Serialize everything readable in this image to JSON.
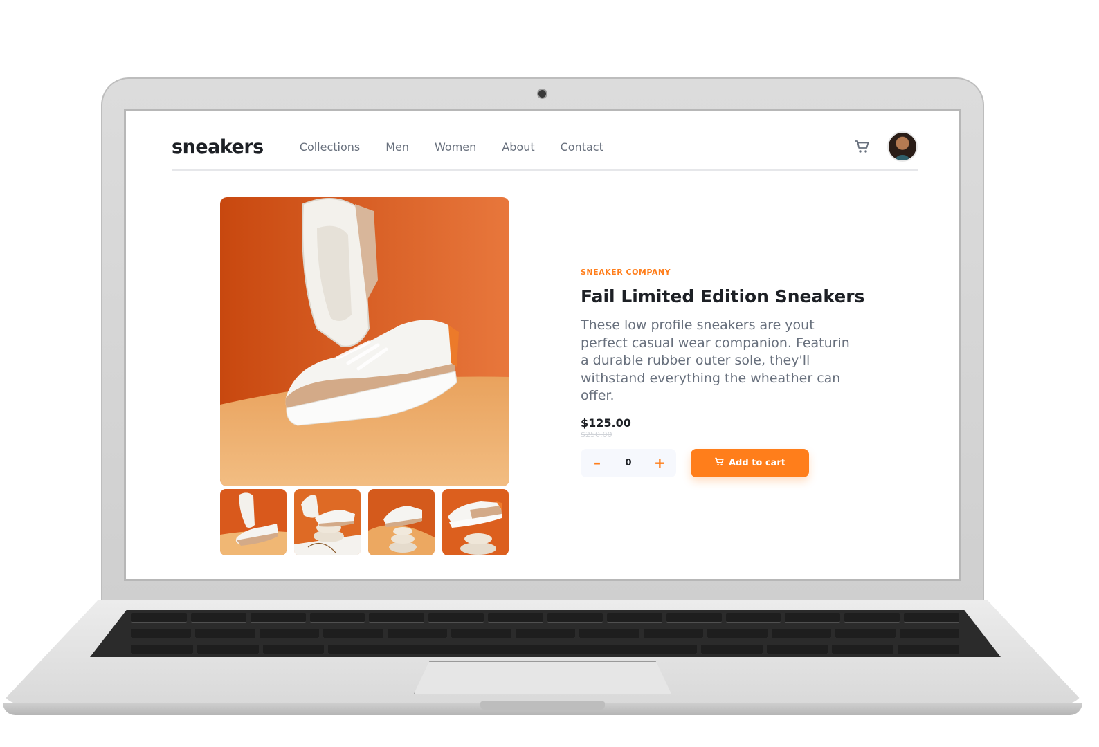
{
  "brand": {
    "logo": "sneakers"
  },
  "nav": {
    "items": [
      {
        "label": "Collections"
      },
      {
        "label": "Men"
      },
      {
        "label": "Women"
      },
      {
        "label": "About"
      },
      {
        "label": "Contact"
      }
    ],
    "cart_icon": "cart-icon",
    "avatar_icon": "avatar"
  },
  "product": {
    "company": "SNEAKER COMPANY",
    "title": "Fail Limited Edition Sneakers",
    "description": "These low profile sneakers are yout perfect casual wear companion. Featurin a durable rubber outer sole, they'll withstand everything the wheather can offer.",
    "price": "$125.00",
    "original_price": "$250.00",
    "quantity": "0",
    "decrement_label": "–",
    "increment_label": "+",
    "add_to_cart_label": "Add to cart"
  },
  "gallery": {
    "thumbnail_count": 4
  },
  "colors": {
    "accent": "#ff7e1b",
    "dark_text": "#1d2025",
    "muted_text": "#68707d",
    "photo_orange": "#d9561a",
    "photo_sand": "#f0b774"
  }
}
